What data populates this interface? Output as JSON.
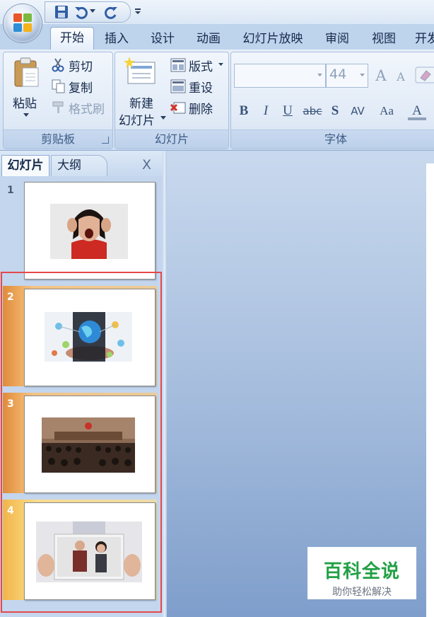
{
  "tabs": [
    "开始",
    "插入",
    "设计",
    "动画",
    "幻灯片放映",
    "审阅",
    "视图",
    "开发"
  ],
  "active_tab": "开始",
  "clipboard": {
    "paste": "粘贴",
    "cut": "剪切",
    "copy": "复制",
    "format_painter": "格式刷",
    "label": "剪贴板"
  },
  "slides_group": {
    "new_slide_line1": "新建",
    "new_slide_line2": "幻灯片",
    "layout": "版式",
    "reset": "重设",
    "delete": "删除",
    "label": "幻灯片"
  },
  "font_group": {
    "font_name": "",
    "font_size": "44",
    "grow_label": "A",
    "shrink_label": "A",
    "bold": "B",
    "italic": "I",
    "underline": "U",
    "strikethrough": "abc",
    "shadow": "S",
    "spacing": "AV",
    "change_case": "Aa",
    "font_color": "A",
    "label": "字体"
  },
  "pane": {
    "tab_slides": "幻灯片",
    "tab_outline": "大纲",
    "close": "X"
  },
  "slides": [
    {
      "number": "1",
      "image": "screaming-woman-photo",
      "selected": false
    },
    {
      "number": "2",
      "image": "globe-in-hand-network-photo",
      "selected": true
    },
    {
      "number": "3",
      "image": "courtroom-photo",
      "selected": true
    },
    {
      "number": "4",
      "image": "couple-photo-in-hands",
      "selected": true
    }
  ],
  "watermark": {
    "title": "百科全说",
    "subtitle": "助你轻松解决"
  },
  "colors": {
    "selection_outline": "#e5484b",
    "selected_row": "#f2b56c",
    "watermark_green": "#21a045"
  }
}
